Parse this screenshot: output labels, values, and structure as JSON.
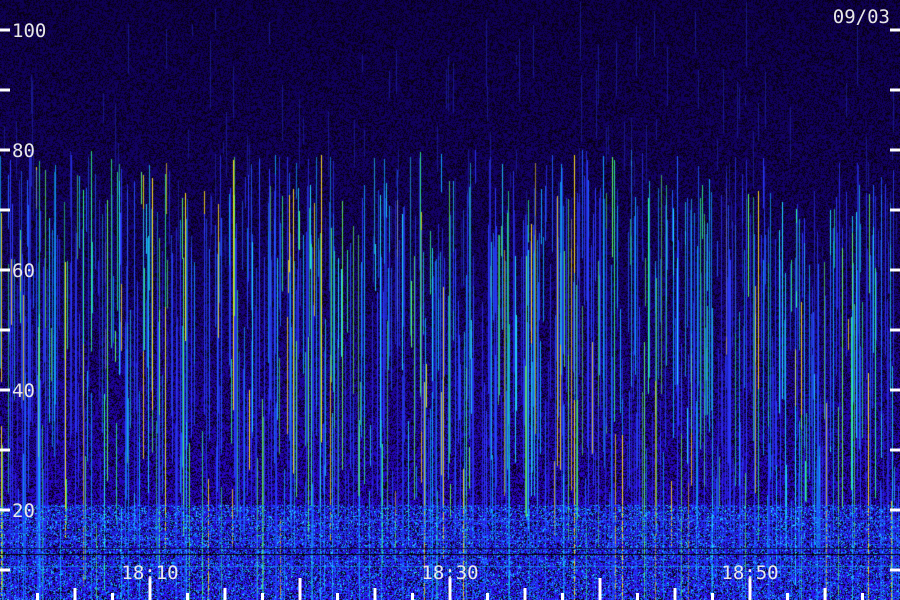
{
  "chart_data": {
    "type": "heatmap",
    "date_label": "09/03",
    "y_tick_labels": [
      "20",
      "40",
      "60",
      "80",
      "100"
    ],
    "y_ticks_all": [
      10,
      20,
      30,
      40,
      50,
      60,
      70,
      80,
      90,
      100
    ],
    "ylim": [
      10,
      105
    ],
    "x_tick_labels": [
      "18:10",
      "18:30",
      "18:50"
    ],
    "x_label_values": [
      "18:10",
      "18:30",
      "18:50"
    ],
    "xlim": [
      "18:00",
      "19:00"
    ],
    "x_minor_step_minutes": 2.5,
    "colormap": [
      "#000000",
      "#2a0060",
      "#3b1cc8",
      "#1a40ff",
      "#10c8ff",
      "#30ff90",
      "#ffe020",
      "#ff3020"
    ],
    "background_color": "#200040",
    "grid": false
  }
}
